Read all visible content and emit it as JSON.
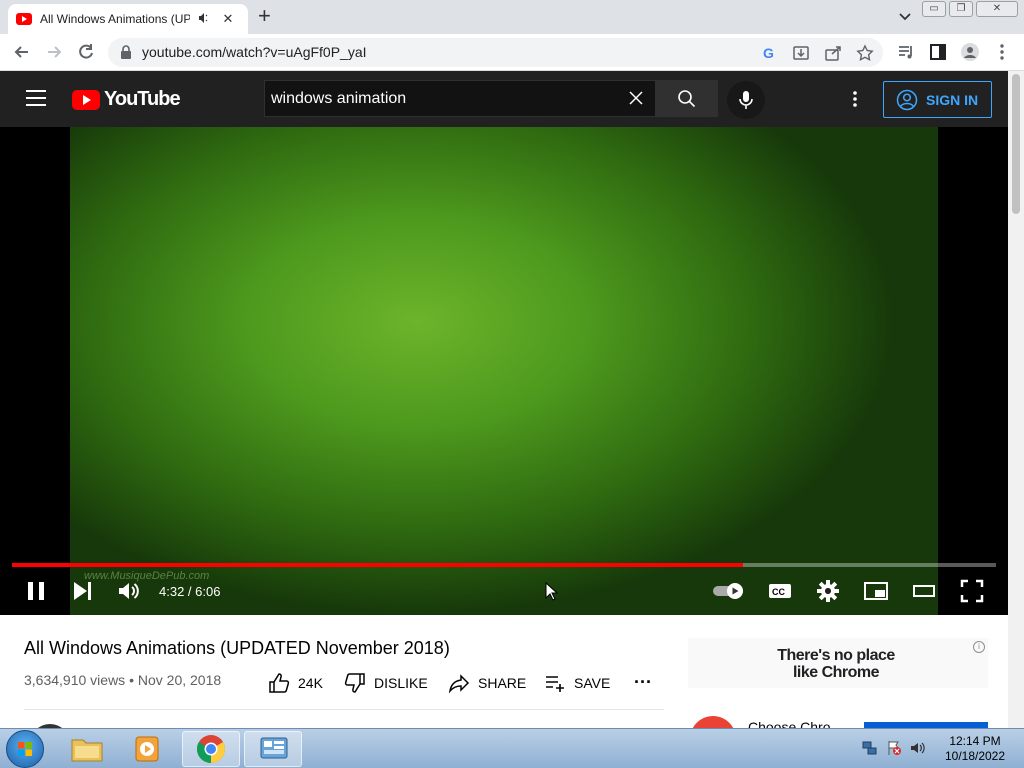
{
  "browser": {
    "tab": {
      "title": "All Windows Animations (UP"
    },
    "window_buttons": {
      "minimize": "▭",
      "restore": "❐",
      "close": "✕"
    },
    "url": "youtube.com/watch?v=uAgFf0P_yaI"
  },
  "youtube": {
    "logo_text": "YouTube",
    "search": {
      "value": "windows animation"
    },
    "signin_label": "SIGN IN"
  },
  "player": {
    "watermark": "www.MusiqueDePub.com",
    "time_display": "4:32 / 6:06",
    "progress_fraction": 0.743
  },
  "video": {
    "title": "All Windows Animations (UPDATED November 2018)",
    "views": "3,634,910 views",
    "date": "Nov 20, 2018",
    "actions": {
      "like": "24K",
      "dislike": "DISLIKE",
      "share": "SHARE",
      "save": "SAVE",
      "more": "···"
    }
  },
  "sidebar": {
    "ad_banner_line1": "There's no place",
    "ad_banner_line2": "like Chrome",
    "ad_info": "i",
    "ad2_title": "Choose Chro"
  },
  "taskbar": {
    "clock_time": "12:14 PM",
    "clock_date": "10/18/2022"
  },
  "colors": {
    "youtube_red": "#ff0000",
    "youtube_header": "#212121",
    "signin_blue": "#3ea6ff",
    "video_green": "#5aa625"
  }
}
